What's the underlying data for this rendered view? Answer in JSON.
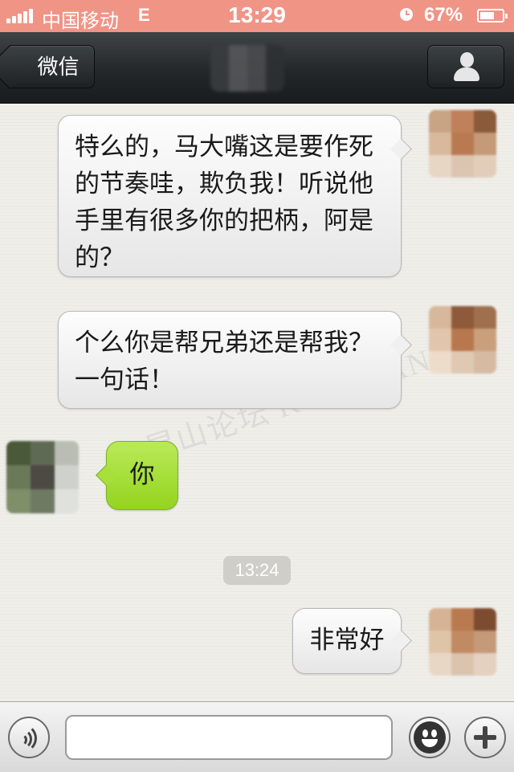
{
  "status_bar": {
    "carrier": "中国移动",
    "network": "E",
    "time": "13:29",
    "battery": "67%",
    "battery_level": 0.67
  },
  "nav": {
    "back_label": "微信"
  },
  "watermark": "昆山论坛 KUNSHAN BBS",
  "messages": [
    {
      "side": "right",
      "text": "特么的，马大嘴这是要作死的节奏哇，欺负我！听说他手里有很多你的把柄，阿是的？"
    },
    {
      "side": "right",
      "text": " 个么你是帮兄弟还是帮我？一句话！"
    },
    {
      "side": "left",
      "text": "你"
    },
    {
      "side": "right",
      "text": "非常好"
    }
  ],
  "timestamp": "13:24",
  "input": {
    "value": "",
    "placeholder": ""
  },
  "icons": {
    "signal": "signal-bars-icon",
    "alarm": "alarm-clock-icon",
    "battery": "battery-icon",
    "back": "back-arrow-icon",
    "profile": "person-icon",
    "voice": "voice-icon",
    "emoji": "emoji-icon",
    "plus": "plus-icon"
  },
  "colors": {
    "status_bar": "#f09486",
    "nav_bar": "#23272a",
    "received_bubble": "#f2f2f2",
    "sent_bubble": "#a7df3c",
    "timestamp_bg": "#cfcec9"
  }
}
